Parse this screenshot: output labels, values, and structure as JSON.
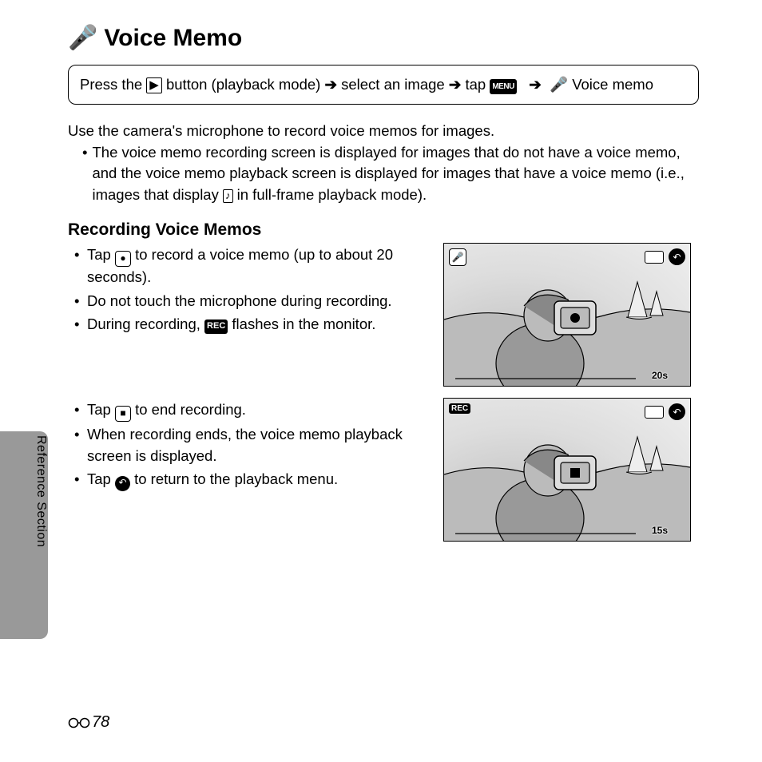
{
  "sidebar": {
    "label": "Reference Section"
  },
  "title": {
    "icon": "mic-icon",
    "text": "Voice Memo"
  },
  "breadcrumb": {
    "prefix": "Press the ",
    "play_glyph": "▶",
    "after_play": " button (playback mode) ",
    "arrow": "➔",
    "select": " select an image ",
    "tap": " tap ",
    "menu_label": "MENU",
    "mic": "🎤",
    "voice_memo": " Voice memo"
  },
  "intro": {
    "line1": "Use the camera's microphone to record voice memos for images.",
    "bullet1": "The voice memo recording screen is displayed for images that do not have a voice memo, and the voice memo playback screen is displayed for images that have a voice memo (i.e., images that display ",
    "audio_glyph": "♪",
    "bullet1_tail": " in full-frame playback mode)."
  },
  "subheading": "Recording Voice Memos",
  "rec": {
    "b1_pre": "Tap ",
    "b1_post": " to record a voice memo (up to about 20 seconds).",
    "b2": "Do not touch the microphone during recording.",
    "b3_pre": "During recording, ",
    "rec_label": "REC",
    "b3_post": " flashes in the monitor.",
    "b4_pre": "Tap ",
    "b4_post": " to end recording.",
    "b5": "When recording ends, the voice memo playback screen is displayed.",
    "b6_pre": "Tap ",
    "b6_post": " to return to the playback menu."
  },
  "screens": {
    "a": {
      "topleft_icon": "🎤",
      "timer": "20s"
    },
    "b": {
      "rec": "REC",
      "timer": "15s"
    }
  },
  "page_number": "78"
}
